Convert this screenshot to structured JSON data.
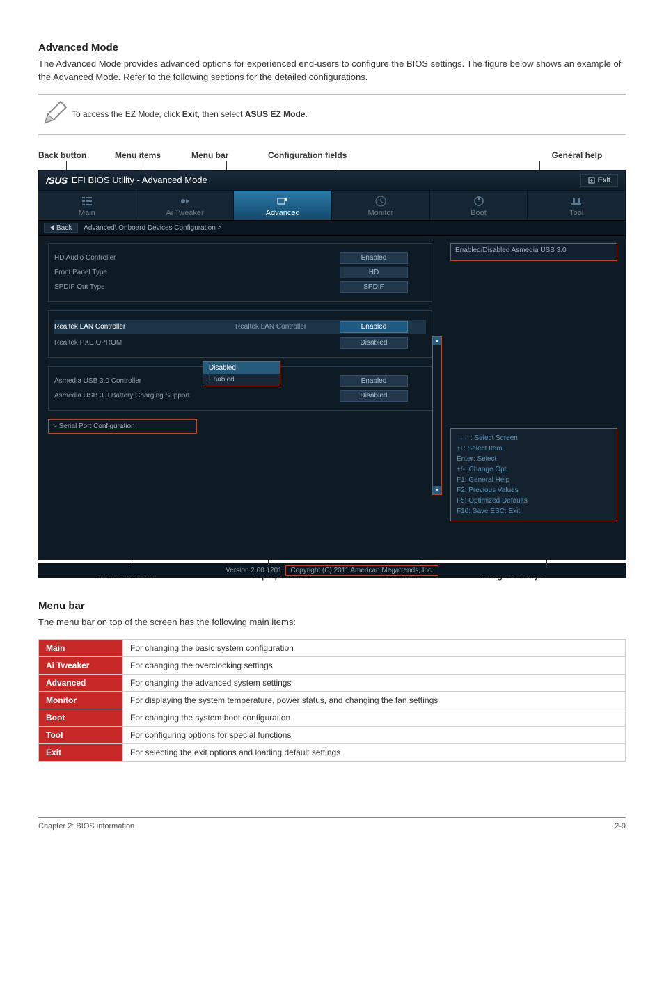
{
  "section_advanced_mode_heading": "Advanced Mode",
  "section_advanced_mode_body": "The Advanced Mode provides advanced options for experienced end-users to configure the BIOS settings. The figure below shows an example of the Advanced Mode. Refer to the following sections for the detailed configurations.",
  "note_prefix": "To access the EZ Mode, click ",
  "note_bold1": "Exit",
  "note_mid": ", then select ",
  "note_bold2": "ASUS EZ Mode",
  "note_suffix": ".",
  "labels_top": {
    "back": "Back button",
    "items": "Menu items",
    "bar": "Menu bar",
    "config": "Configuration fields",
    "help": "General help"
  },
  "labels_bottom": {
    "submenu": "Submenu item",
    "popup": "Pop-up window",
    "scroll": "Scroll bar",
    "nav": "Navigation keys"
  },
  "bios": {
    "title": "EFI BIOS Utility - Advanced Mode",
    "exit": "Exit",
    "tabs": {
      "main": "Main",
      "ai": "Ai Tweaker",
      "advanced": "Advanced",
      "monitor": "Monitor",
      "boot": "Boot",
      "tool": "Tool"
    },
    "breadcrumb_back": "Back",
    "breadcrumb_path": "Advanced\\ Onboard Devices Configuration  >",
    "group1": {
      "hd_audio": "HD Audio Controller",
      "hd_audio_val": "Enabled",
      "front_panel": "Front Panel Type",
      "front_panel_val": "HD",
      "spdif": "SPDIF Out Type",
      "spdif_val": "SPDIF"
    },
    "group2": {
      "realtek_lan": "Realtek LAN Controller",
      "realtek_lan_sub": "Realtek LAN Controller",
      "realtek_lan_val": "Enabled",
      "realtek_pxe": "Realtek PXE OPROM",
      "realtek_pxe_val": "Disabled"
    },
    "popup": {
      "opt1": "Disabled",
      "opt2": "Enabled"
    },
    "group3": {
      "asmedia": "Asmedia USB 3.0 Controller",
      "asmedia_val": "Enabled",
      "charging": "Asmedia USB 3.0 Battery Charging Support",
      "charging_val": "Disabled"
    },
    "submenu": "Serial Port Configuration",
    "help_text": "Enabled/Disabled Asmedia USB 3.0",
    "keys": {
      "l1": "→←:  Select Screen",
      "l2": "↑↓:  Select Item",
      "l3": "Enter:  Select",
      "l4": "+/-:  Change Opt.",
      "l5": "F1:  General Help",
      "l6": "F2:  Previous Values",
      "l7": "F5:  Optimized Defaults",
      "l8": "F10:  Save   ESC:  Exit"
    },
    "version": "Version 2.00.1201.",
    "copyright": "Copyright (C) 2011 American Megatrends, Inc."
  },
  "menubar_heading": "Menu bar",
  "menubar_body": "The menu bar on top of the screen has the following main items:",
  "menu_table": [
    {
      "h": "Main",
      "d": "For changing the basic system configuration"
    },
    {
      "h": "Ai Tweaker",
      "d": "For changing the overclocking settings"
    },
    {
      "h": "Advanced",
      "d": "For changing the advanced system settings"
    },
    {
      "h": "Monitor",
      "d": "For displaying the system temperature, power status, and changing the fan settings"
    },
    {
      "h": "Boot",
      "d": "For changing the system boot configuration"
    },
    {
      "h": "Tool",
      "d": "For configuring options for special functions"
    },
    {
      "h": "Exit",
      "d": "For selecting the exit options and loading default settings"
    }
  ],
  "footer_left": "Chapter 2: BIOS information",
  "footer_right": "2-9"
}
